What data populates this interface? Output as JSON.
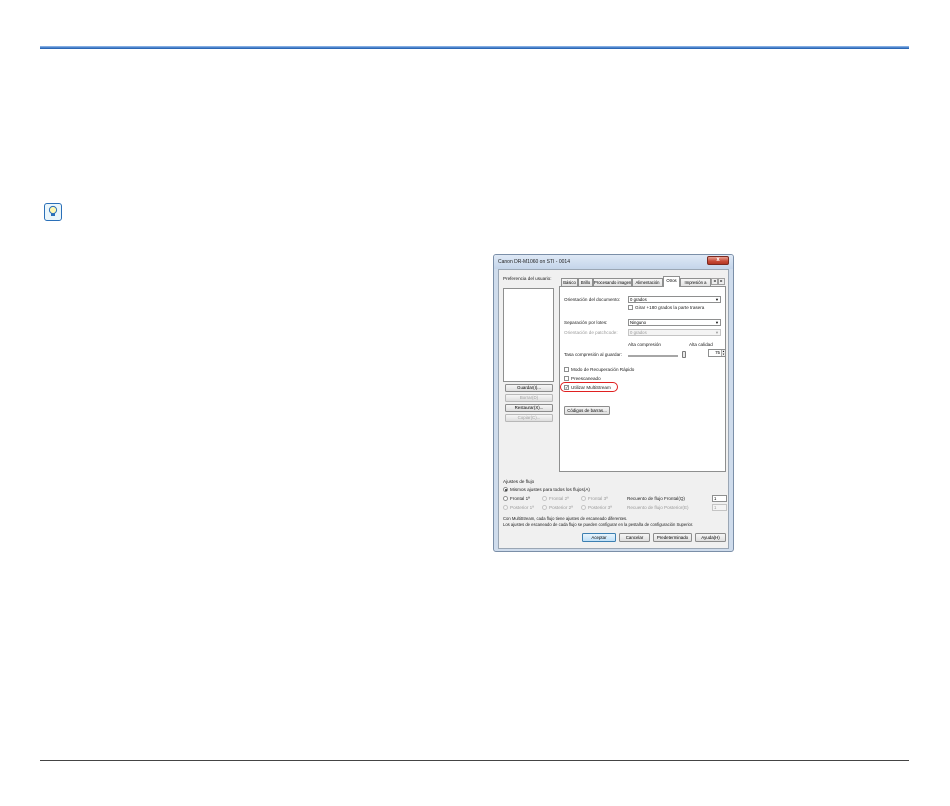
{
  "dialog": {
    "title": "Canon DR-M1060 on STI - 0014",
    "close_glyph": "x",
    "preferences_label": "Preferencia del usuario:",
    "pref_buttons": {
      "save": "Guardar(I)...",
      "delete": "Borrar(D)",
      "restore": "Restaurar(X)...",
      "copy": "Copiar(C)..."
    },
    "tabs": [
      "Básico",
      "Brillo",
      "Procesando imagen",
      "Alimentación",
      "Otros",
      "Impresión a"
    ],
    "tab_scroll": [
      "◄",
      "►"
    ],
    "panel": {
      "orientation_label": "Orientación del documento:",
      "orientation_value": "0 grados",
      "rotate_back_label": "Girar +180 grados la parte trasera",
      "separation_label": "Separación por lotes:",
      "separation_value": "Ninguno",
      "patchcode_label": "Orientación de patchcode:",
      "patchcode_value": "0 grados",
      "high_compression": "Alta compresión",
      "high_quality": "Alta calidad",
      "compression_label": "Tasa compresión al guardar:",
      "compression_value": "75",
      "fast_recovery_label": "Modo de Recuperación Rápido",
      "prescan_label": "Preescaneado",
      "multistream_label": "Utilizar MultiStream",
      "barcode_button": "Códigos de barras..."
    },
    "stream": {
      "group_title": "Ajustes de flujo",
      "same_settings_label": "Mismos ajustes para todos los flujos(A)",
      "front_labels": [
        "Frontal 1ª",
        "Frontal 2ª",
        "Frontal 3ª"
      ],
      "back_labels": [
        "Posterior 1ª",
        "Posterior 2ª",
        "Posterior 3ª"
      ],
      "front_count_label": "Recuento de flujo Frontal(Q)",
      "front_count_value": "1",
      "back_count_label": "Recuento de flujo Posterior(E)",
      "back_count_value": "1",
      "note_line1": "Con MultiStream, cada flujo tiene ajustes de escaneado diferentes.",
      "note_line2": "Los ajustes de escaneado de cada flujo se pueden configurar en la pestaña de configuración Superior."
    },
    "footer_buttons": {
      "ok": "Aceptar",
      "cancel": "Cancelar",
      "default": "Predeterminado",
      "help": "Ayuda(H)"
    }
  }
}
